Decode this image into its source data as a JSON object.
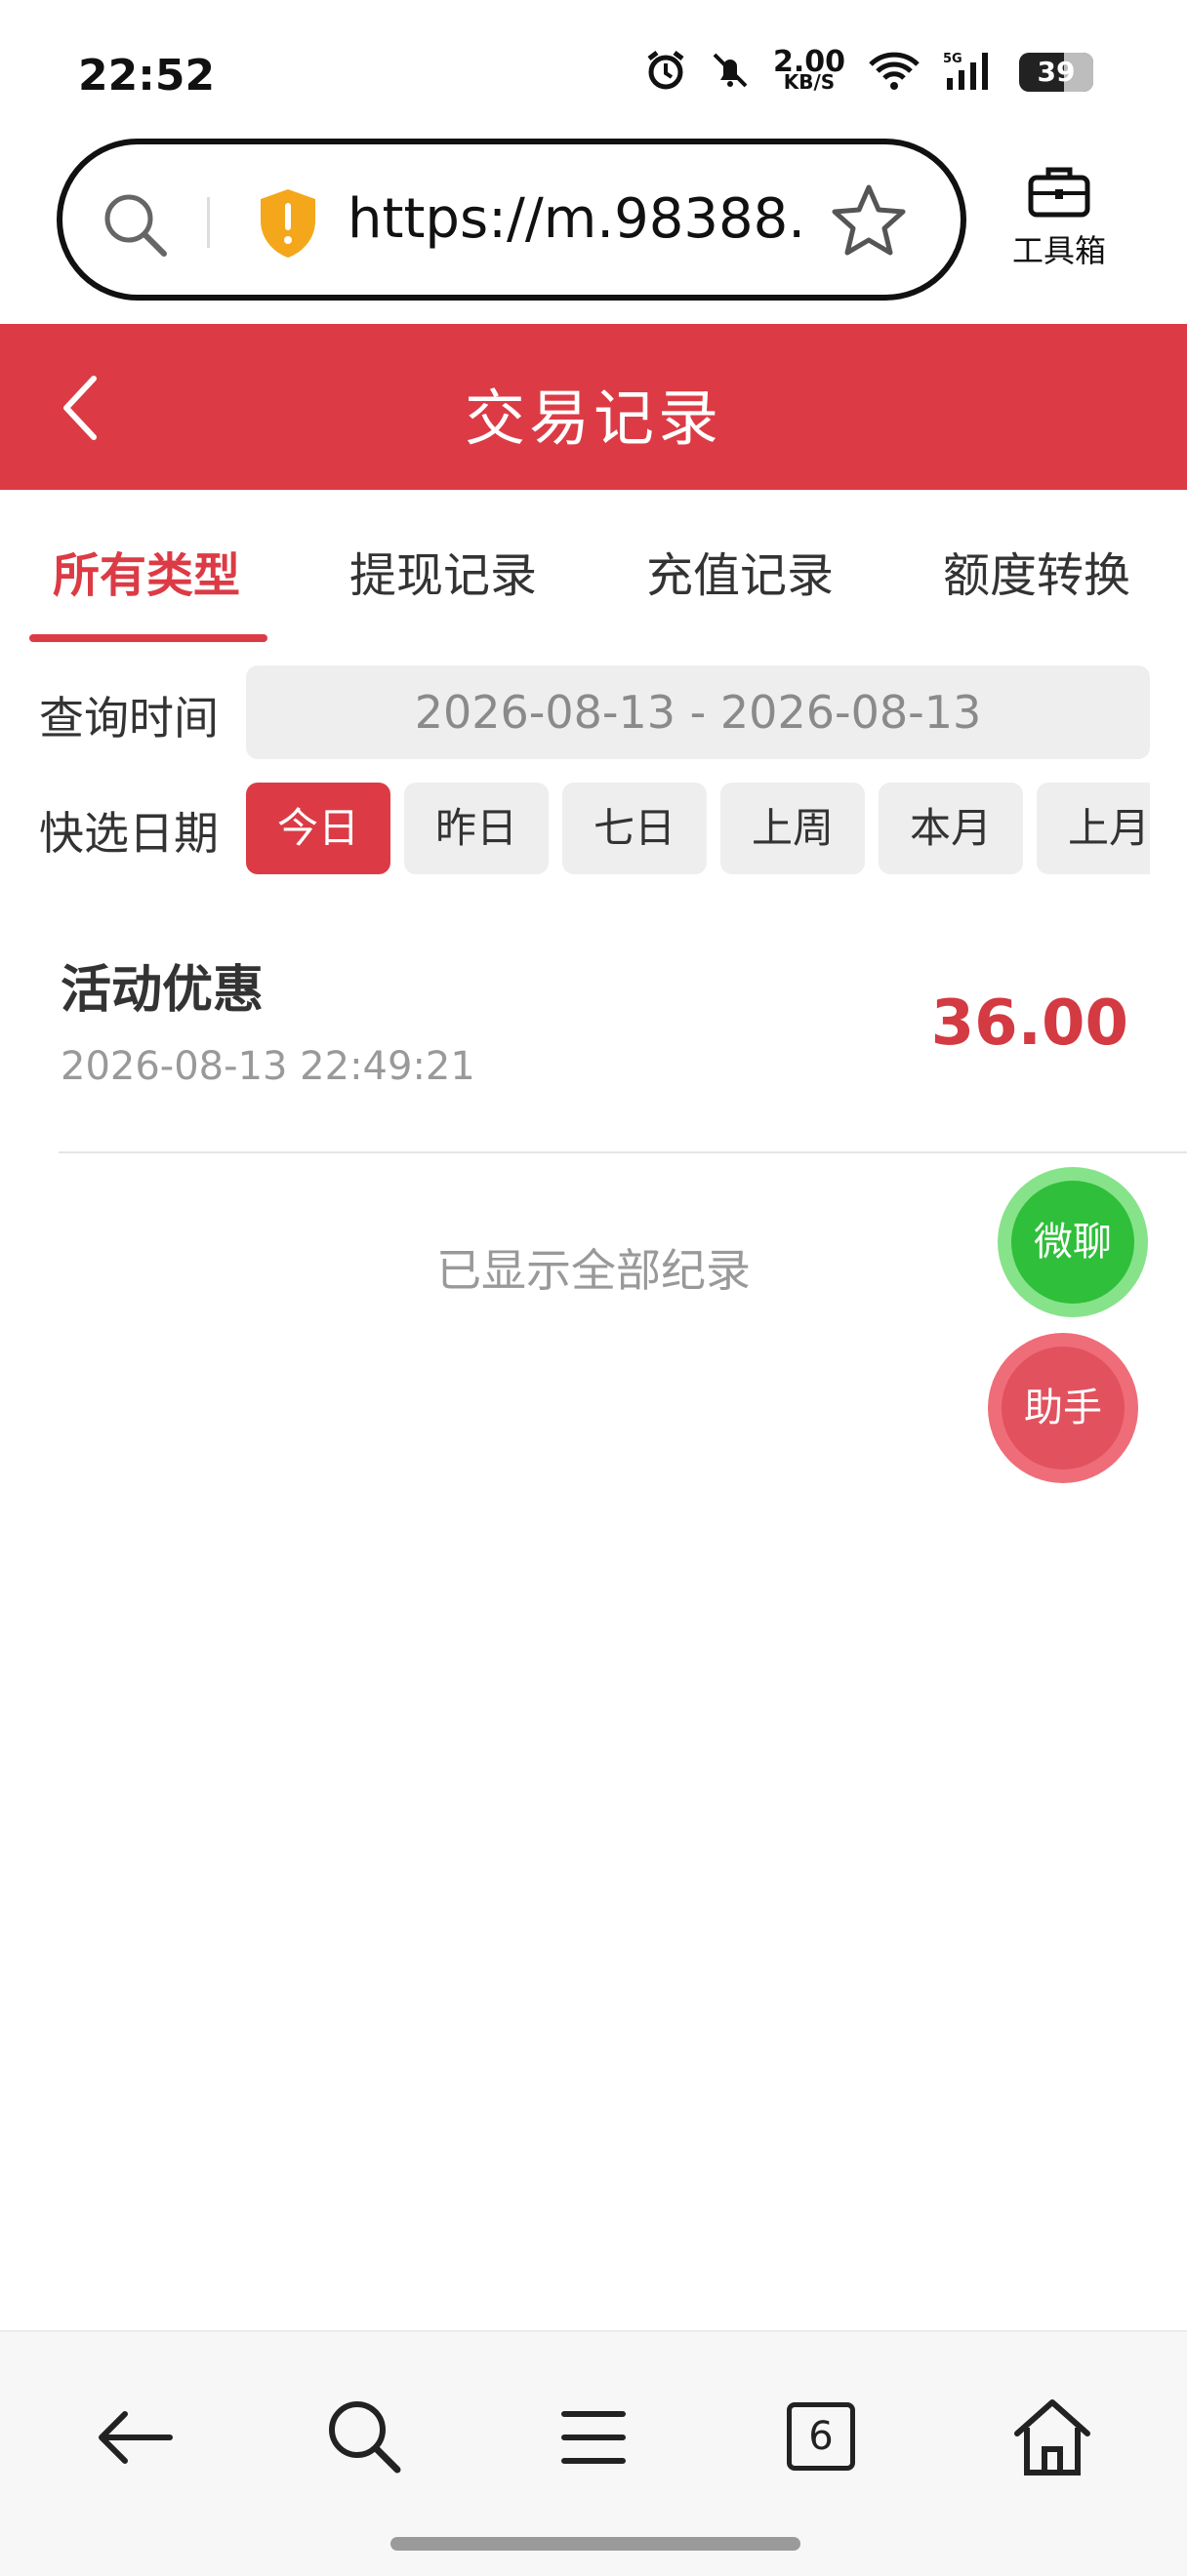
{
  "status_bar": {
    "time": "22:52",
    "net_speed_value": "2.00",
    "net_speed_unit": "KB/S",
    "signal_label": "5G",
    "battery_level": "39",
    "battery_fraction": 0.39
  },
  "browser": {
    "url": "https://m.98388...",
    "toolbox_label": "工具箱",
    "tab_count": "6"
  },
  "header": {
    "title": "交易记录"
  },
  "tabs": [
    {
      "label": "所有类型",
      "active": true
    },
    {
      "label": "提现记录",
      "active": false
    },
    {
      "label": "充值记录",
      "active": false
    },
    {
      "label": "额度转换",
      "active": false
    }
  ],
  "query": {
    "time_label": "查询时间",
    "date_range": "2026-08-13 - 2026-08-13",
    "quick_label": "快选日期",
    "chips": [
      {
        "label": "今日",
        "active": true
      },
      {
        "label": "昨日",
        "active": false
      },
      {
        "label": "七日",
        "active": false
      },
      {
        "label": "上周",
        "active": false
      },
      {
        "label": "本月",
        "active": false
      },
      {
        "label": "上月",
        "active": false
      }
    ]
  },
  "records": [
    {
      "title": "活动优惠",
      "time": "2026-08-13 22:49:21",
      "amount": "36.00"
    }
  ],
  "footer_text": "已显示全部纪录",
  "floating": {
    "wechat_label": "微聊",
    "helper_label": "助手"
  },
  "colors": {
    "brand_red": "#dc3b45",
    "chat_green": "#2fbf3a"
  }
}
